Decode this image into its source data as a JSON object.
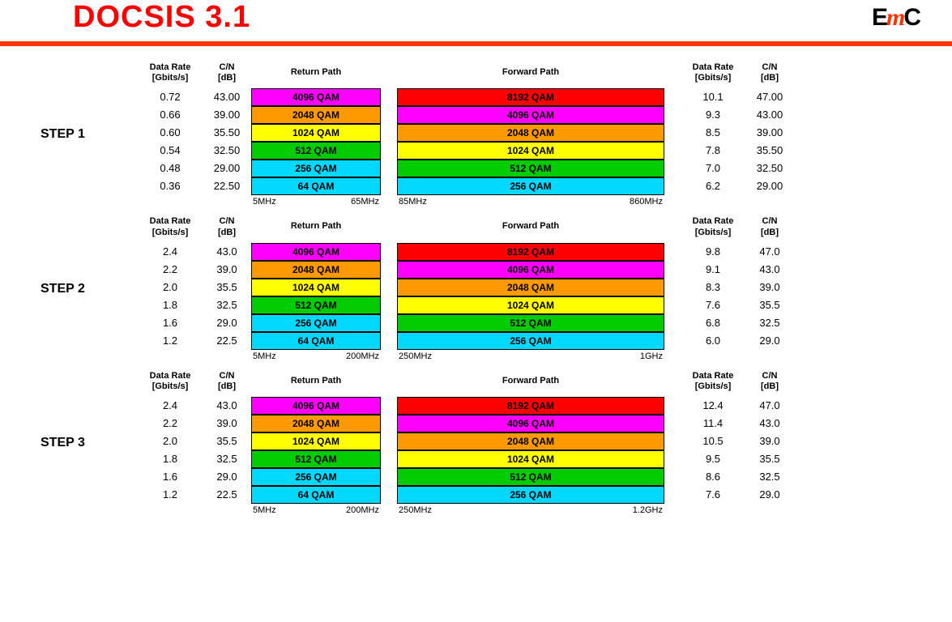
{
  "title": "DOCSIS 3.1",
  "logo": {
    "e": "E",
    "m": "m",
    "c": "C"
  },
  "headers": {
    "dataRate": "Data Rate\n[Gbits/s]",
    "cn": "C/N\n[dB]",
    "returnPath": "Return Path",
    "forwardPath": "Forward Path"
  },
  "qamColors": {
    "8192": "#ff0000",
    "4096": "#ff00ff",
    "2048": "#ff9900",
    "1024": "#ffff00",
    "512": "#00cc00",
    "256": "#00d8ff",
    "64": "#00d8ff"
  },
  "steps": [
    {
      "label": "STEP 1",
      "freq": {
        "retLow": "5MHz",
        "retHigh": "65MHz",
        "fwdLow": "85MHz",
        "fwdHigh": "860MHz"
      },
      "rows": [
        {
          "rateL": "0.72",
          "cnL": "43.00",
          "ret": "4096 QAM",
          "retColor": "4096",
          "fwd": "8192 QAM",
          "fwdColor": "8192",
          "rateR": "10.1",
          "cnR": "47.00"
        },
        {
          "rateL": "0.66",
          "cnL": "39.00",
          "ret": "2048 QAM",
          "retColor": "2048",
          "fwd": "4096 QAM",
          "fwdColor": "4096",
          "rateR": "9.3",
          "cnR": "43.00"
        },
        {
          "rateL": "0.60",
          "cnL": "35.50",
          "ret": "1024 QAM",
          "retColor": "1024",
          "fwd": "2048 QAM",
          "fwdColor": "2048",
          "rateR": "8.5",
          "cnR": "39.00"
        },
        {
          "rateL": "0.54",
          "cnL": "32.50",
          "ret": "512 QAM",
          "retColor": "512",
          "fwd": "1024 QAM",
          "fwdColor": "1024",
          "rateR": "7.8",
          "cnR": "35.50"
        },
        {
          "rateL": "0.48",
          "cnL": "29.00",
          "ret": "256 QAM",
          "retColor": "256",
          "fwd": "512 QAM",
          "fwdColor": "512",
          "rateR": "7.0",
          "cnR": "32.50"
        },
        {
          "rateL": "0.36",
          "cnL": "22.50",
          "ret": "64 QAM",
          "retColor": "64",
          "fwd": "256 QAM",
          "fwdColor": "256",
          "rateR": "6.2",
          "cnR": "29.00"
        }
      ]
    },
    {
      "label": "STEP 2",
      "freq": {
        "retLow": "5MHz",
        "retHigh": "200MHz",
        "fwdLow": "250MHz",
        "fwdHigh": "1GHz"
      },
      "rows": [
        {
          "rateL": "2.4",
          "cnL": "43.0",
          "ret": "4096 QAM",
          "retColor": "4096",
          "fwd": "8192 QAM",
          "fwdColor": "8192",
          "rateR": "9.8",
          "cnR": "47.0"
        },
        {
          "rateL": "2.2",
          "cnL": "39.0",
          "ret": "2048 QAM",
          "retColor": "2048",
          "fwd": "4096 QAM",
          "fwdColor": "4096",
          "rateR": "9.1",
          "cnR": "43.0"
        },
        {
          "rateL": "2.0",
          "cnL": "35.5",
          "ret": "1024 QAM",
          "retColor": "1024",
          "fwd": "2048 QAM",
          "fwdColor": "2048",
          "rateR": "8.3",
          "cnR": "39.0"
        },
        {
          "rateL": "1.8",
          "cnL": "32.5",
          "ret": "512 QAM",
          "retColor": "512",
          "fwd": "1024 QAM",
          "fwdColor": "1024",
          "rateR": "7.6",
          "cnR": "35.5"
        },
        {
          "rateL": "1.6",
          "cnL": "29.0",
          "ret": "256 QAM",
          "retColor": "256",
          "fwd": "512 QAM",
          "fwdColor": "512",
          "rateR": "6.8",
          "cnR": "32.5"
        },
        {
          "rateL": "1.2",
          "cnL": "22.5",
          "ret": "64 QAM",
          "retColor": "64",
          "fwd": "256 QAM",
          "fwdColor": "256",
          "rateR": "6.0",
          "cnR": "29.0"
        }
      ]
    },
    {
      "label": "STEP 3",
      "freq": {
        "retLow": "5MHz",
        "retHigh": "200MHz",
        "fwdLow": "250MHz",
        "fwdHigh": "1.2GHz"
      },
      "rows": [
        {
          "rateL": "2.4",
          "cnL": "43.0",
          "ret": "4096 QAM",
          "retColor": "4096",
          "fwd": "8192 QAM",
          "fwdColor": "8192",
          "rateR": "12.4",
          "cnR": "47.0"
        },
        {
          "rateL": "2.2",
          "cnL": "39.0",
          "ret": "2048 QAM",
          "retColor": "2048",
          "fwd": "4096 QAM",
          "fwdColor": "4096",
          "rateR": "11.4",
          "cnR": "43.0"
        },
        {
          "rateL": "2.0",
          "cnL": "35.5",
          "ret": "1024 QAM",
          "retColor": "1024",
          "fwd": "2048 QAM",
          "fwdColor": "2048",
          "rateR": "10.5",
          "cnR": "39.0"
        },
        {
          "rateL": "1.8",
          "cnL": "32.5",
          "ret": "512 QAM",
          "retColor": "512",
          "fwd": "1024 QAM",
          "fwdColor": "1024",
          "rateR": "9.5",
          "cnR": "35.5"
        },
        {
          "rateL": "1.6",
          "cnL": "29.0",
          "ret": "256 QAM",
          "retColor": "256",
          "fwd": "512 QAM",
          "fwdColor": "512",
          "rateR": "8.6",
          "cnR": "32.5"
        },
        {
          "rateL": "1.2",
          "cnL": "22.5",
          "ret": "64 QAM",
          "retColor": "64",
          "fwd": "256 QAM",
          "fwdColor": "256",
          "rateR": "7.6",
          "cnR": "29.0"
        }
      ]
    }
  ]
}
